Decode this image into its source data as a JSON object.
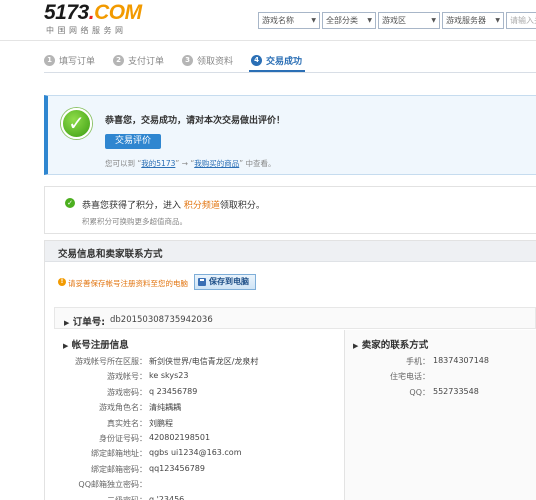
{
  "logo": {
    "text_main": "5173",
    "text_dot": ".",
    "text_com": "COM",
    "subtitle": "中国网络服务网"
  },
  "search": {
    "selects": [
      {
        "label": "游戏名称",
        "width": 62
      },
      {
        "label": "全部分类",
        "width": 54
      },
      {
        "label": "游戏区",
        "width": 62
      },
      {
        "label": "游戏服务器",
        "width": 62
      }
    ],
    "input_placeholder": "请输入关"
  },
  "steps": [
    {
      "num": "1",
      "label": "填写订单"
    },
    {
      "num": "2",
      "label": "支付订单"
    },
    {
      "num": "3",
      "label": "领取资料"
    },
    {
      "num": "4",
      "label": "交易成功"
    }
  ],
  "success": {
    "title": "恭喜您，交易成功，请对本次交易做出评价！",
    "eval_button": "交易评价",
    "note_prefix": "您可以到 “",
    "note_link1": "我的5173",
    "note_mid": "” → “",
    "note_link2": "我购买的商品",
    "note_suffix": "” 中查看。"
  },
  "points": {
    "line_prefix": "恭喜您获得了积分，进入 ",
    "line_link": "积分频道",
    "line_suffix": "领取积分。",
    "sub": "积累积分可换购更多超值商品。"
  },
  "trade": {
    "title": "交易信息和卖家联系方式",
    "warning": "请妥善保存帐号注册资料至您的电脑",
    "save_button": "保存到电脑",
    "order_label": "订单号:",
    "order_no": "db20150308735942036",
    "account_title": "帐号注册信息",
    "account_fields": [
      {
        "label": "游戏帐号所在区服：",
        "value": "新剑侠世界/电信青龙区/龙泉村"
      },
      {
        "label": "游戏帐号：",
        "value": "ke   skys23"
      },
      {
        "label": "游戏密码：",
        "value": "q   23456789"
      },
      {
        "label": "游戏角色名：",
        "value": "清纯耦耦"
      },
      {
        "label": "真实姓名：",
        "value": "刘鹏程"
      },
      {
        "label": "身份证号码：",
        "value": "420802198501"
      },
      {
        "label": "绑定邮箱地址：",
        "value": "qgbs     ui1234@163.com"
      },
      {
        "label": "绑定邮箱密码：",
        "value": "qq123456789"
      },
      {
        "label": "QQ邮箱独立密码：",
        "value": ""
      },
      {
        "label": "二级密码：",
        "value": "q   '23456"
      }
    ],
    "seller_title": "卖家的联系方式",
    "seller_fields": [
      {
        "label": "手机：",
        "value": "18374307148"
      },
      {
        "label": "住宅电话：",
        "value": ""
      },
      {
        "label": "QQ：",
        "value": "552733548"
      }
    ]
  }
}
